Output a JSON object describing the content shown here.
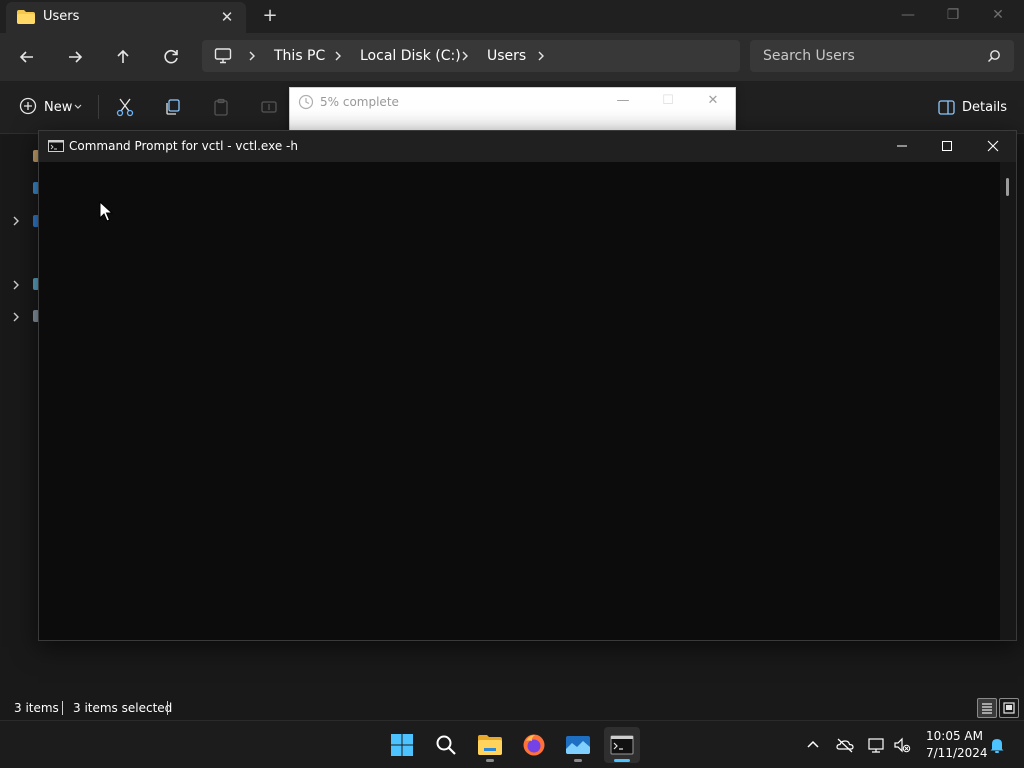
{
  "explorer": {
    "tab_title": "Users",
    "tab_close": "✕",
    "new_tab": "+",
    "window_controls": {
      "minimize": "—",
      "restore": "❐",
      "close": "✕"
    },
    "breadcrumb": [
      "This PC",
      "Local Disk (C:)",
      "Users"
    ],
    "search_placeholder": "Search Users",
    "toolbar": {
      "new_label": "New",
      "details_label": "Details"
    },
    "status": {
      "item_count": "3 items",
      "selected": "3 items selected"
    }
  },
  "progress_dialog": {
    "title": "5% complete",
    "controls": {
      "minimize": "—",
      "maximize": "☐",
      "close": "✕"
    }
  },
  "cmd_window": {
    "title": "Command Prompt for vctl - vctl.exe  -h"
  },
  "taskbar": {
    "apps": [
      "start-icon",
      "search-icon",
      "file-explorer-icon",
      "firefox-icon",
      "photos-icon",
      "terminal-icon"
    ],
    "time": "10:05 AM",
    "date": "7/11/2024"
  },
  "colors": {
    "accent": "#4cc2ff",
    "folder": "#f5c84c",
    "explorer_bg": "#191919",
    "cmd_bg": "#0c0c0c"
  }
}
